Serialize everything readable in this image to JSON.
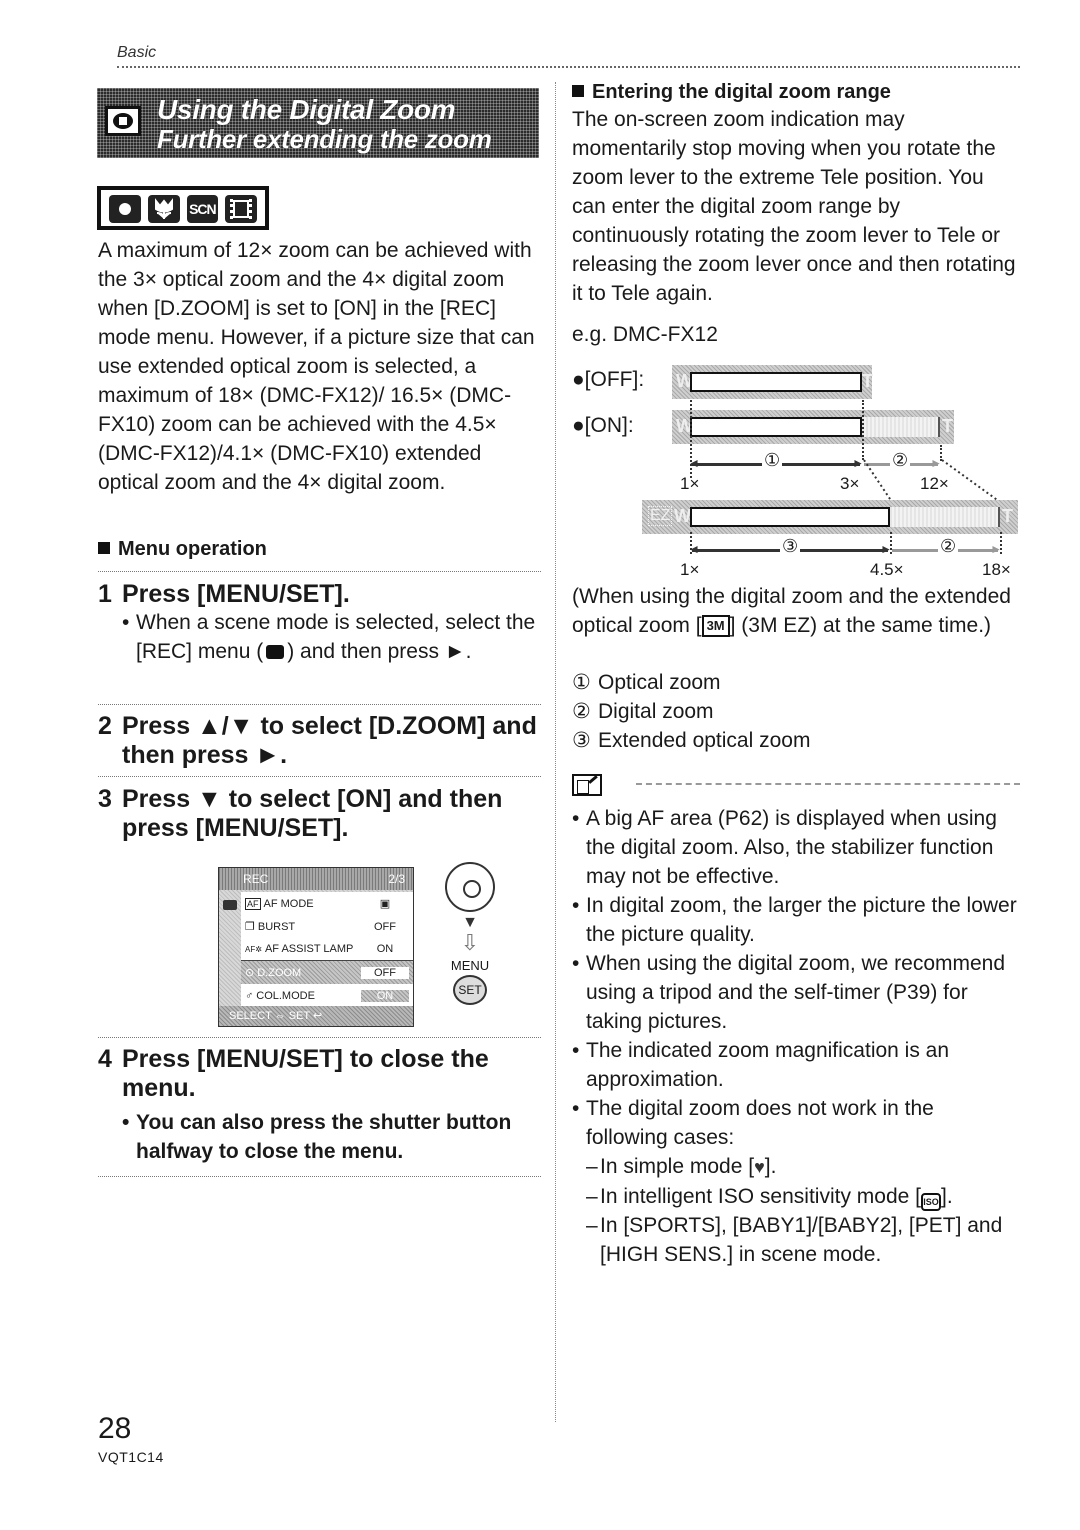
{
  "header": {
    "section": "Basic"
  },
  "banner": {
    "icon": "zoom-mode-icon",
    "title": "Using the Digital Zoom",
    "subtitle": "Further extending the zoom"
  },
  "mode_icons": [
    {
      "name": "normal-picture-mode-icon",
      "label": ""
    },
    {
      "name": "macro-mode-icon",
      "label": ""
    },
    {
      "name": "scene-mode-icon",
      "label": "SCN"
    },
    {
      "name": "motion-picture-mode-icon",
      "label": ""
    }
  ],
  "intro": "A maximum of 12× zoom can be achieved with the 3× optical zoom and the 4× digital zoom when [D.ZOOM] is set to [ON] in the [REC] mode menu. However, if a picture size that can use extended optical zoom is selected, a maximum of  18× (DMC-FX12)/ 16.5× (DMC-FX10) zoom can be achieved with the 4.5× (DMC-FX12)/4.1× (DMC-FX10) extended optical zoom and the 4× digital zoom.",
  "menu_operation": {
    "heading": "Menu operation",
    "steps": [
      {
        "num": "1",
        "text": "Press [MENU/SET].",
        "note_before_icon": "When a scene mode is selected, select the [REC] menu (",
        "note_icon": "rec-camera-icon",
        "note_after_icon": ") and then press ►."
      },
      {
        "num": "2",
        "text": "Press ▲/▼ to select [D.ZOOM] and then press ►."
      },
      {
        "num": "3",
        "text": "Press ▼ to select [ON] and then press [MENU/SET]."
      },
      {
        "num": "4",
        "text": "Press [MENU/SET] to close the menu.",
        "note": "You can also press the shutter button halfway to close the menu."
      }
    ]
  },
  "camera_screen": {
    "title": "REC",
    "page": "2/3",
    "rows": [
      {
        "icon": "AF",
        "label": "AF MODE",
        "value": "▣"
      },
      {
        "icon": "❐",
        "label": "BURST",
        "value": "OFF"
      },
      {
        "icon": "AF✲",
        "label": "AF ASSIST LAMP",
        "value": "ON"
      },
      {
        "icon": "⊙",
        "label": "D.ZOOM",
        "value": "OFF"
      },
      {
        "icon": "♂",
        "label": "COL.MODE",
        "value": "ON"
      }
    ],
    "footer": "SELECT ⇔ SET ↩"
  },
  "controls": {
    "down_arrow": "▼",
    "flow_arrow": "⇩",
    "menu_label": "MENU",
    "set_label": "SET"
  },
  "digital_zoom_range": {
    "heading": "Entering the digital zoom range",
    "body": "The on-screen zoom indication may momentarily stop moving when you rotate the zoom lever to the extreme Tele position. You can enter the digital zoom range by continuously rotating the zoom lever to Tele or releasing the zoom lever once and then rotating it to Tele again.",
    "example": "e.g. DMC-FX12"
  },
  "zoom_diagram": {
    "off_label": "●[OFF]:",
    "on_label": "●[ON]:",
    "wide_cap": "W",
    "tele_cap": "T",
    "ez_cap": "EZ",
    "row1_ticks": [
      "1×",
      "3×",
      "12×"
    ],
    "row2_ticks": [
      "1×",
      "4.5×",
      "18×"
    ],
    "markers": [
      "①",
      "②",
      "③",
      "②"
    ]
  },
  "diagram_caption": {
    "before_icon": "(When using the digital zoom and the extended optical zoom [",
    "icon": "3M",
    "after_icon": "] (3M EZ) at the same time.)"
  },
  "legend": [
    {
      "marker": "①",
      "text": "Optical zoom"
    },
    {
      "marker": "②",
      "text": "Digital zoom"
    },
    {
      "marker": "③",
      "text": "Extended optical zoom"
    }
  ],
  "notes": {
    "icon": "note-book-icon",
    "items": [
      "A big AF area (P62) is displayed when using the digital zoom. Also, the stabilizer function may not be effective.",
      "In digital zoom, the larger the picture the lower the picture quality.",
      "When using the digital zoom, we recommend using a tripod and the self-timer (P39) for taking pictures.",
      "The indicated zoom magnification is an approximation.",
      "The digital zoom does not work in the following cases:"
    ],
    "cases": [
      {
        "before": "In simple mode [",
        "icon": "♥",
        "after": "]."
      },
      {
        "before": "In intelligent ISO sensitivity mode [",
        "icon": "ISO",
        "after": "]."
      },
      {
        "before": "In [SPORTS], [BABY1]/[BABY2],  [PET] and [HIGH SENS.] in scene mode.",
        "icon": "",
        "after": ""
      }
    ]
  },
  "footer": {
    "page_number": "28",
    "doc_code": "VQT1C14"
  }
}
